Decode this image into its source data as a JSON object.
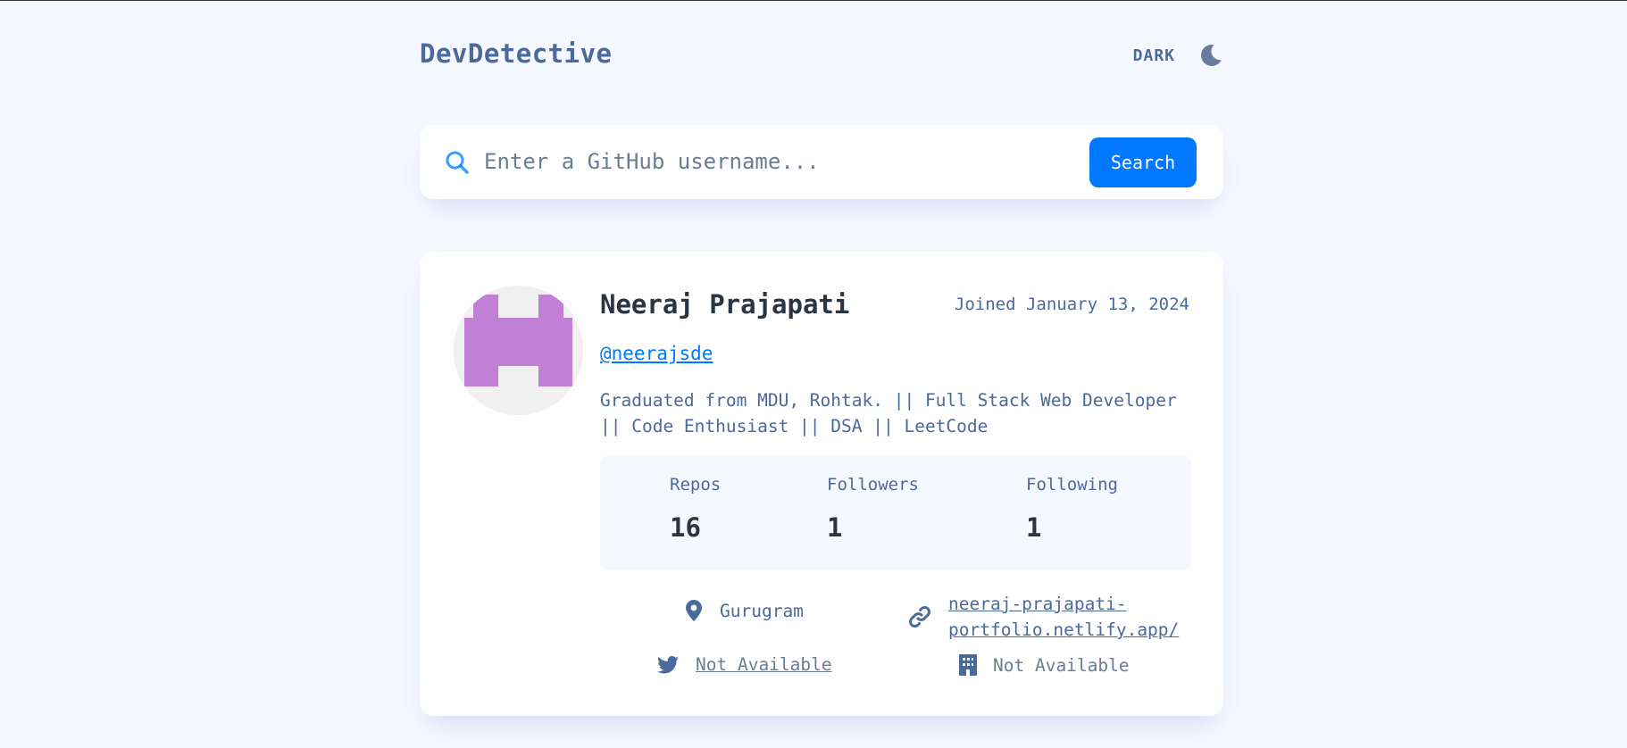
{
  "header": {
    "logo": "DevDetective",
    "mode_label": "DARK",
    "mode_icon": "moon-icon"
  },
  "search": {
    "placeholder": "Enter a GitHub username...",
    "value": "",
    "button_label": "Search",
    "icon": "search-icon"
  },
  "profile": {
    "name": "Neeraj Prajapati",
    "joined": "Joined January 13, 2024",
    "login": "@neerajsde",
    "bio": "Graduated from MDU, Rohtak. || Full Stack Web Developer || Code Enthusiast || DSA || LeetCode",
    "stats": {
      "repos_label": "Repos",
      "repos": "16",
      "followers_label": "Followers",
      "followers": "1",
      "following_label": "Following",
      "following": "1"
    },
    "links": {
      "location": "Gurugram",
      "website_line1": "neeraj-prajapati-",
      "website_line2": "portfolio.netlify.app/",
      "twitter": "Not Available",
      "company": "Not Available"
    }
  },
  "colors": {
    "background": "#f6f8ff",
    "card": "#fefefe",
    "accent": "#0079ff",
    "text": "#4b6a9b",
    "heading": "#2b3442",
    "avatar": "#c180d6"
  }
}
